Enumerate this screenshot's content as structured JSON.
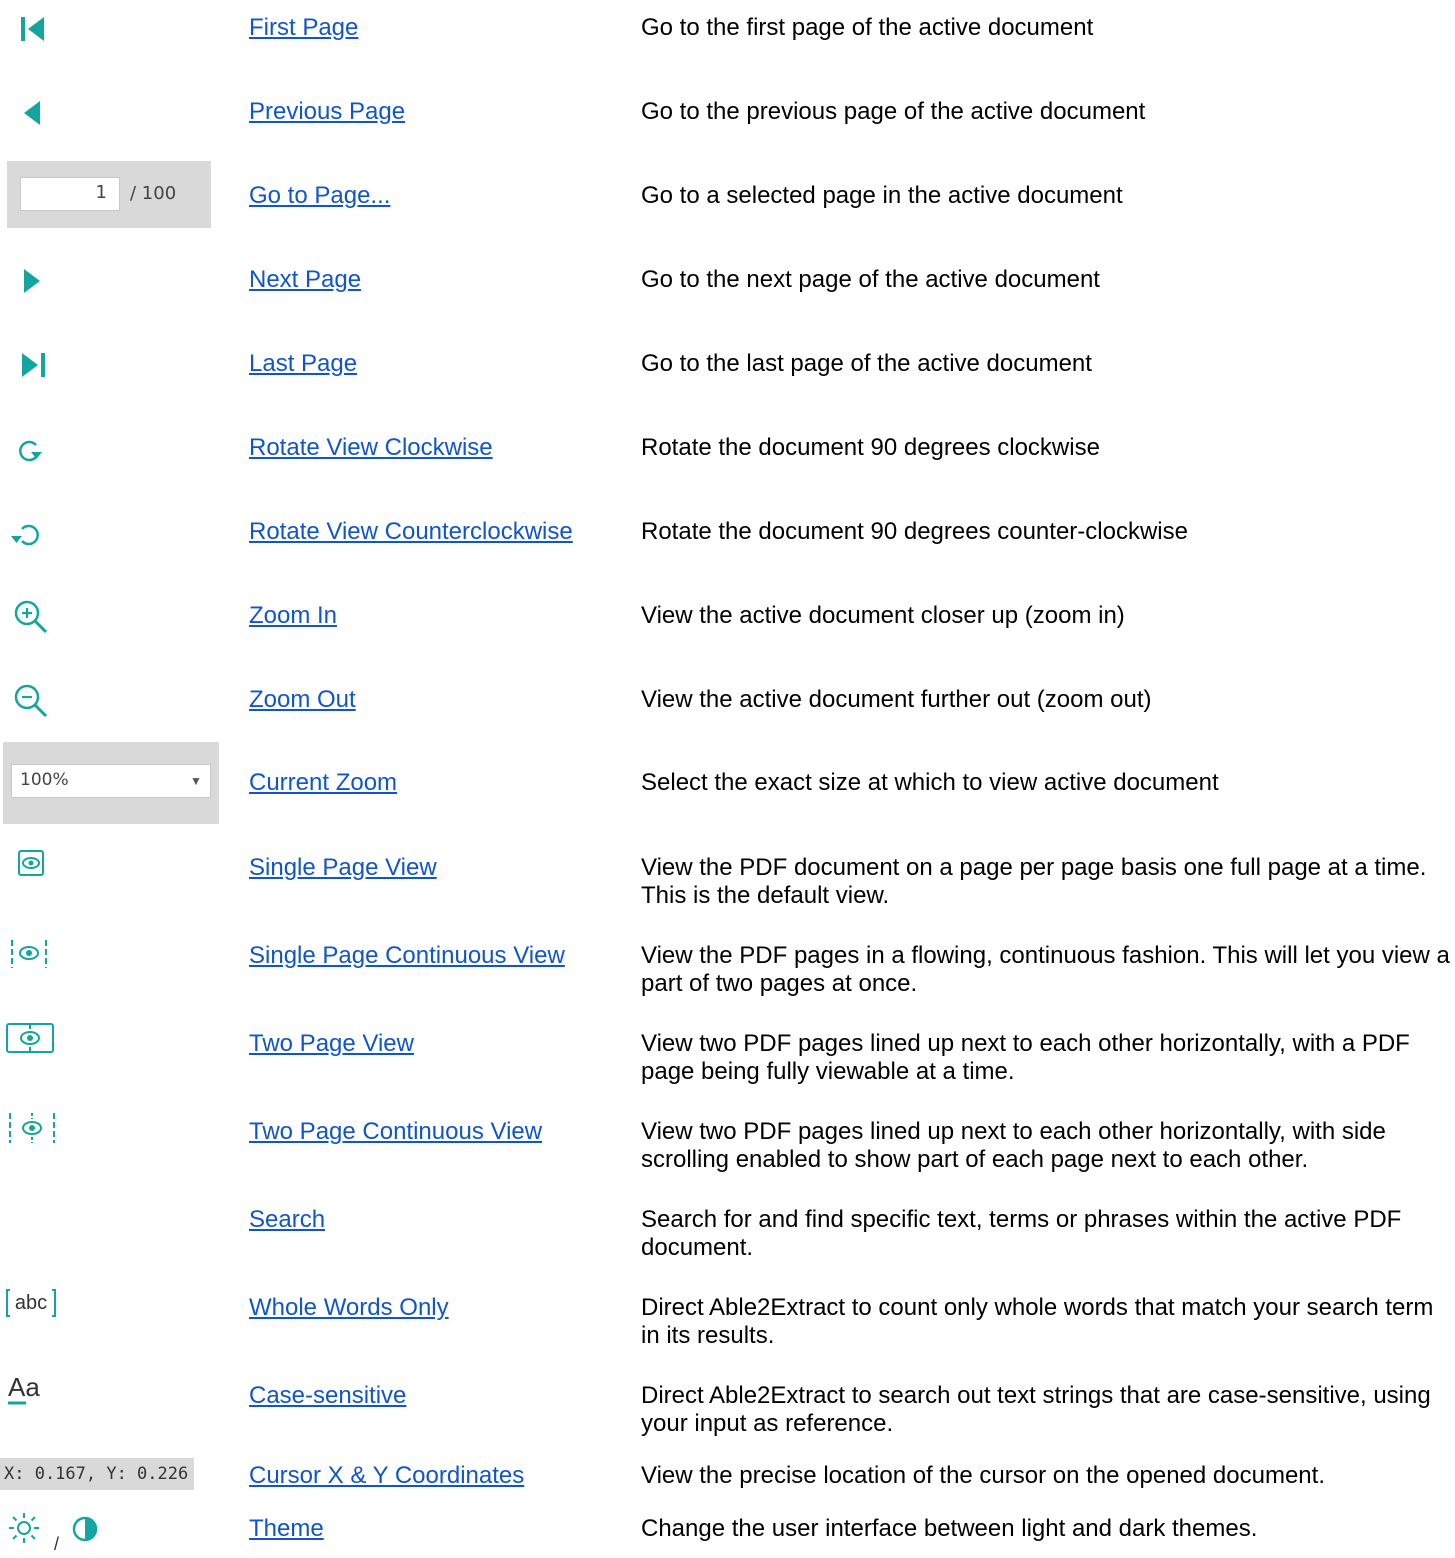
{
  "colors": {
    "teal": "#14a5a0",
    "link": "#1155cc",
    "panel": "#d9d9d9"
  },
  "rows": [
    {
      "icon": "first-page-icon",
      "name": "First Page",
      "desc": "Go to the first page of the active document"
    },
    {
      "icon": "previous-page-icon",
      "name": "Previous Page",
      "desc": "Go to the previous page of the active document"
    },
    {
      "icon": "page-number-input",
      "name": "Go to Page...",
      "desc": "Go to a selected page in the active document"
    },
    {
      "icon": "next-page-icon",
      "name": "Next Page",
      "desc": "Go to the next page of the active document"
    },
    {
      "icon": "last-page-icon",
      "name": "Last Page",
      "desc": "Go to the last page of the active document"
    },
    {
      "icon": "rotate-clockwise-icon",
      "name": "Rotate View Clockwise",
      "desc": "Rotate the document 90 degrees clockwise"
    },
    {
      "icon": "rotate-counterclockwise-icon",
      "name": "Rotate View Counterclockwise",
      "desc": "Rotate the document 90 degrees counter-clockwise"
    },
    {
      "icon": "zoom-in-icon",
      "name": "Zoom In",
      "desc": "View the active document closer up (zoom in)"
    },
    {
      "icon": "zoom-out-icon",
      "name": "Zoom Out",
      "desc": "View the active document further out (zoom out)"
    },
    {
      "icon": "zoom-dropdown",
      "name": "Current Zoom",
      "desc": "Select the exact size at which to view active document"
    },
    {
      "icon": "single-page-view-icon",
      "name": "Single Page View",
      "desc": "View the PDF document on a page per page basis one full page at a time. This is the default view."
    },
    {
      "icon": "single-page-continuous-icon",
      "name": "Single Page Continuous View",
      "desc": "View the PDF pages in a flowing, continuous fashion. This will let you view a part of two pages at once."
    },
    {
      "icon": "two-page-view-icon",
      "name": "Two Page View",
      "desc": "View two PDF pages lined up next to each other horizontally, with a PDF page being fully viewable at a time."
    },
    {
      "icon": "two-page-continuous-icon",
      "name": "Two Page Continuous View",
      "desc": "View two PDF pages lined up next to each other horizontally, with side scrolling enabled to show part of each page next to each other."
    },
    {
      "icon": "",
      "name": "Search",
      "desc": "Search for and find specific text, terms or phrases within the active PDF document."
    },
    {
      "icon": "whole-words-icon",
      "name": "Whole Words Only",
      "desc": "Direct Able2Extract to count only whole words that match your search term in its results."
    },
    {
      "icon": "case-sensitive-icon",
      "name": "Case-sensitive",
      "desc": "Direct Able2Extract to search out text strings that are case-sensitive, using your input as reference."
    },
    {
      "icon": "coordinates-readout",
      "name": "Cursor X & Y Coordinates",
      "desc": "View the precise location of the cursor on the opened document."
    },
    {
      "icon": "theme-icons",
      "name": "Theme",
      "desc": "Change the user interface between light and dark themes."
    }
  ],
  "page_input": {
    "value": "1",
    "separator": "/ 100"
  },
  "zoom_select": {
    "value": "100%",
    "arrow": "▼"
  },
  "coordinates": {
    "text": "X: 0.167, Y: 0.226"
  },
  "theme_separator": "/",
  "icon_glyphs": {
    "abc": "abc",
    "aa": "Aa"
  }
}
